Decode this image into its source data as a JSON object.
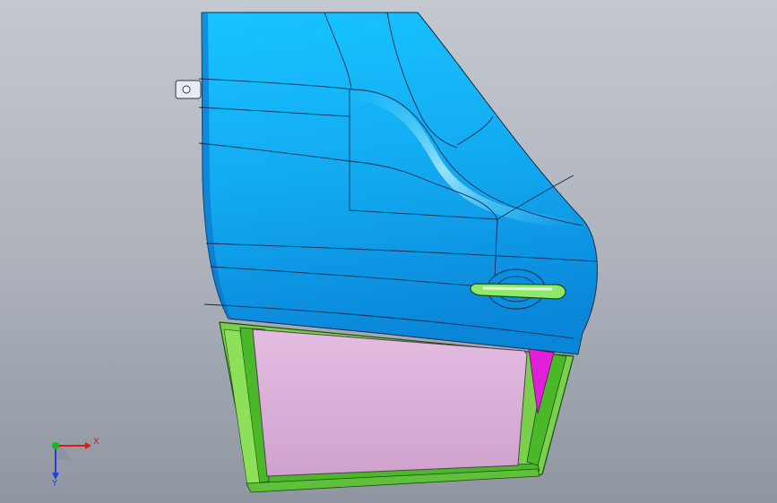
{
  "viewport": {
    "background_top": "#c4c8cf",
    "background_bottom": "#8f96a1"
  },
  "model": {
    "panel_color": "#1ab8f5",
    "panel_shadow": "#0b7fd6",
    "window_color": "#dcb0d8",
    "frame_color": "#5fd23c",
    "accent_color": "#e020d8",
    "handle_color": "#8ee86a"
  },
  "triad": {
    "x_label": "X",
    "y_label": "Y",
    "x_color": "#e01818",
    "y_color": "#18b818",
    "z_color": "#2040d8",
    "icon": "coordinate-triad-icon"
  }
}
